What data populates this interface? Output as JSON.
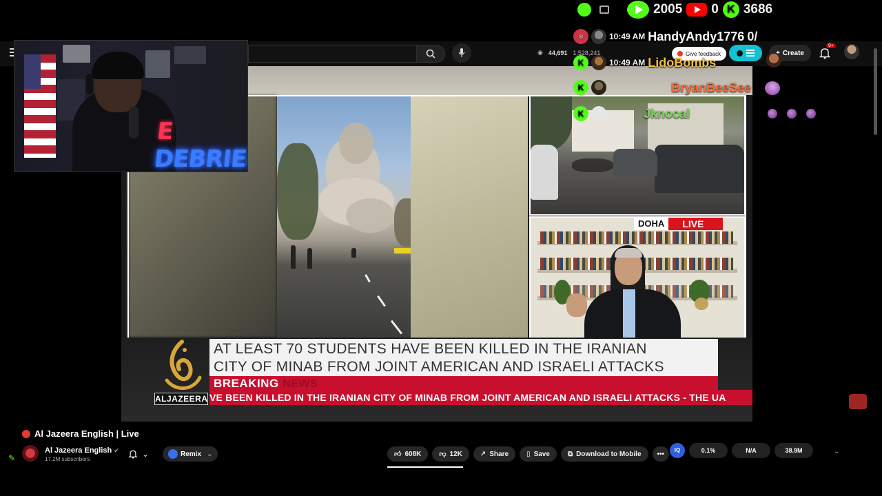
{
  "overlay": {
    "counters": {
      "kick_count": "2005",
      "youtube_count": "0",
      "kick_live_count": "3686"
    },
    "chat": [
      {
        "time": "10:49 AM",
        "user": "HandyAndy1776",
        "message": "0/",
        "user_color": "#ffffff"
      },
      {
        "time": "10:49 AM",
        "user": "LidoBombs",
        "message": "",
        "user_color": "#f2c040"
      },
      {
        "time": "",
        "user": "BryanBeeSee",
        "message": "",
        "user_color": "#ff6f3c"
      },
      {
        "time": "",
        "user": "Jknocal",
        "message": "",
        "user_color": "#7bd35a"
      }
    ]
  },
  "topbar": {
    "search_placeholder": "",
    "viewers_a": "44,691",
    "viewers_b": "1,528,241",
    "feedback_label": "Give feedback",
    "create_label": "Create",
    "notif_badge": "9+"
  },
  "webcam": {
    "sign_prefix": "E",
    "sign_text": "DEBRIEF"
  },
  "video": {
    "doha_label": "DOHA",
    "live_label": "LIVE",
    "network_name": "ALJAZEERA",
    "headline_line1": "AT LEAST 70 STUDENTS HAVE BEEN KILLED IN THE IRANIAN",
    "headline_line2": "CITY OF MINAB FROM JOINT AMERICAN AND ISRAELI ATTACKS",
    "breaking_label": "BREAKING",
    "news_label": "NEWS",
    "ticker": "VE BEEN KILLED IN THE IRANIAN CITY OF MINAB FROM JOINT AMERICAN AND ISRAELI ATTACKS   -   THE UA"
  },
  "watch": {
    "title": "Al Jazeera English | Live",
    "channel_name": "Al Jazeera English",
    "subscribers": "17.2M subscribers",
    "remix_label": "Remix",
    "likes": "608K",
    "dislikes": "12K",
    "share_label": "Share",
    "save_label": "Save",
    "download_label": "Download to Mobile",
    "stat1": "0.1%",
    "stat2": "N/A",
    "stat3": "38.9M",
    "iq_label": "IQ"
  },
  "colors": {
    "aj_red": "#c8102e",
    "kick_green": "#53fc18",
    "youtube_red": "#ff0000"
  }
}
